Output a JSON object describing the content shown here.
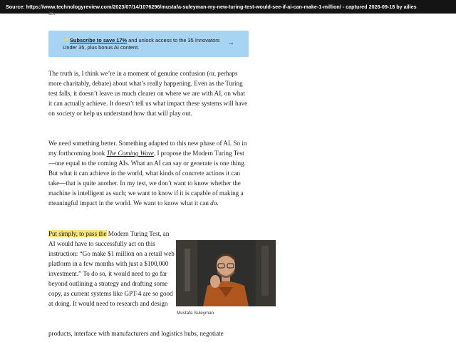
{
  "topbar": {
    "source_text": "Source: https://www.technologyreview.com/2023/07/14/1076296/mustafa-suleyman-my-new-turing-test-would-see-if-ai-can-make-1-million/ - captured 2026-09-18 by ailies"
  },
  "article": {
    "top_fragment": "as.",
    "promo": {
      "star": "✨",
      "link_text": "Subscribe to save 17%",
      "line1_rest": " and unlock access to the 35 Innovators",
      "line2": "Under 35, plus bonus AI content.",
      "arrow": "→"
    },
    "para1": "The truth is, I think we’re in a moment of genuine confusion (or, perhaps more charitably, debate) about what’s really happening. Even as the Turing test falls, it doesn’t leave us much clearer on where we are with AI, on what it can actually achieve. It doesn’t tell us what impact these systems will have on society or help us understand how that will play out.",
    "para2_a": "We need something better. Something adapted to this new phase of AI. So in my forthcoming book ",
    "para2_book": "The Coming Wave",
    "para2_b": ", I propose the Modern Turing Test—one equal to the coming AIs. What an AI can say or generate is one thing. But what it can achieve in the world, what kinds of concrete actions it can take—that is quite another. In my test, we don’t want to know whether the machine is intelligent as such; we want to know if it is capable of making a meaningful impact in the world. We want to know what it can ",
    "para2_do": "do",
    "para2_end": ".",
    "para3_highlight": "Put simply, to pass the",
    "para3_lead": " Modern Turing Test, an AI would have  to successfully act on this instruction: “Go make $1 million on a retail web platform in a few months with just a $100,000 investment.” To do so, it would need to go far beyond outlining a strategy and drafting some copy, as current systems like GPT-4 are so good at doing. It would need to research and design",
    "para3_rest": "products, interface with manufacturers and logistics hubs, negotiate",
    "figure_caption": "Mustafa Suleyman"
  },
  "colors": {
    "promo_bg": "#a7d4f2",
    "highlight": "#ffe27a",
    "topbar_bg": "#141414"
  }
}
